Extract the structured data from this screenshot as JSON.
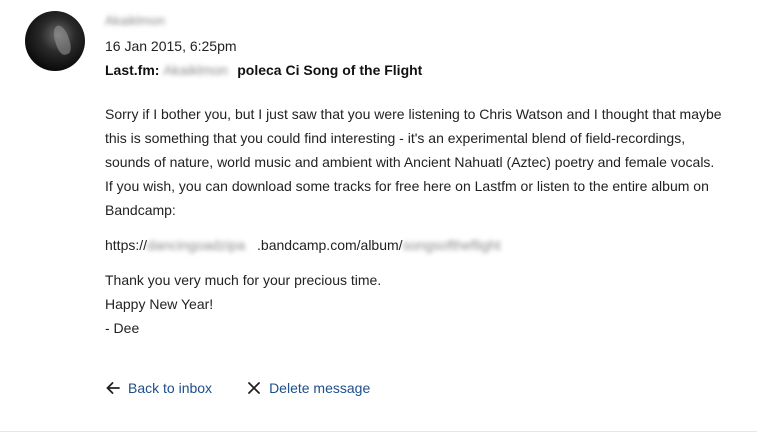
{
  "message": {
    "sender_name": "Akaiklmon",
    "timestamp": "16 Jan 2015, 6:25pm",
    "subject_prefix": "Last.fm:",
    "subject_sender": "Akaiklmon",
    "subject_suffix": "poleca Ci Song of the Flight",
    "body_paragraph": "Sorry if I bother you, but I just saw that you were listening to Chris Watson and I thought that maybe this is something that you could find interesting - it's an experimental blend of field-recordings, sounds of nature, world music and ambient with Ancient Nahuatl (Aztec) poetry and female vocals. If you wish, you can download some tracks for free here on Lastfm or listen to the entire album on Bandcamp:",
    "url_prefix": "https://",
    "url_host_blurred": "dancingoadzipa",
    "url_middle": ".bandcamp.com/album/",
    "url_path_blurred": "songsoftheflight",
    "closing_line_1": "Thank you very much for your precious time.",
    "closing_line_2": "Happy New Year!",
    "closing_line_3": "- Dee"
  },
  "actions": {
    "back_label": "Back to inbox",
    "back_icon": "arrow-left-icon",
    "delete_label": "Delete message",
    "delete_icon": "close-icon"
  },
  "colors": {
    "link": "#1d4e89",
    "text": "#222222",
    "blurred": "#8a8a8a"
  }
}
